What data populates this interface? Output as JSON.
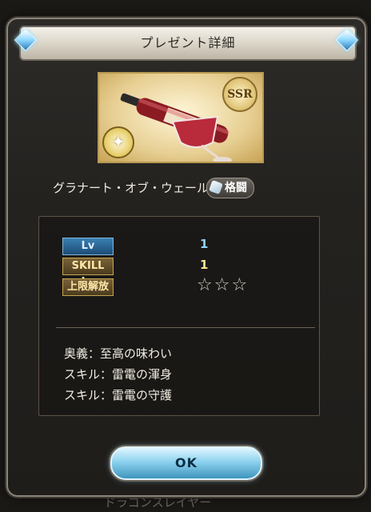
{
  "dialog": {
    "title": "プレゼント詳細"
  },
  "item": {
    "rarity": "SSR",
    "name": "グラナート・オブ・ウェールズ",
    "weapon_type": "格闘"
  },
  "stats": {
    "lv_label": "Lv",
    "lv_value": "1",
    "skill_lv_label": "SKILL Lv",
    "skill_lv_value": "1",
    "limit_break_label": "上限解放",
    "limit_break_stars": "☆☆☆"
  },
  "details": {
    "ougi": "奥義：至高の味わい",
    "skill_1": "スキル：雷電の渾身",
    "skill_2": "スキル：雷電の守護"
  },
  "buttons": {
    "ok": "OK"
  },
  "background": {
    "bottom_label": "ドラゴンスレイヤー"
  },
  "colors": {
    "ok_button": "#8ed2ef",
    "lv_label_bg": "#2c6a99",
    "gold_label_bg": "#6a5430",
    "accent_gold": "#c7a64e"
  }
}
